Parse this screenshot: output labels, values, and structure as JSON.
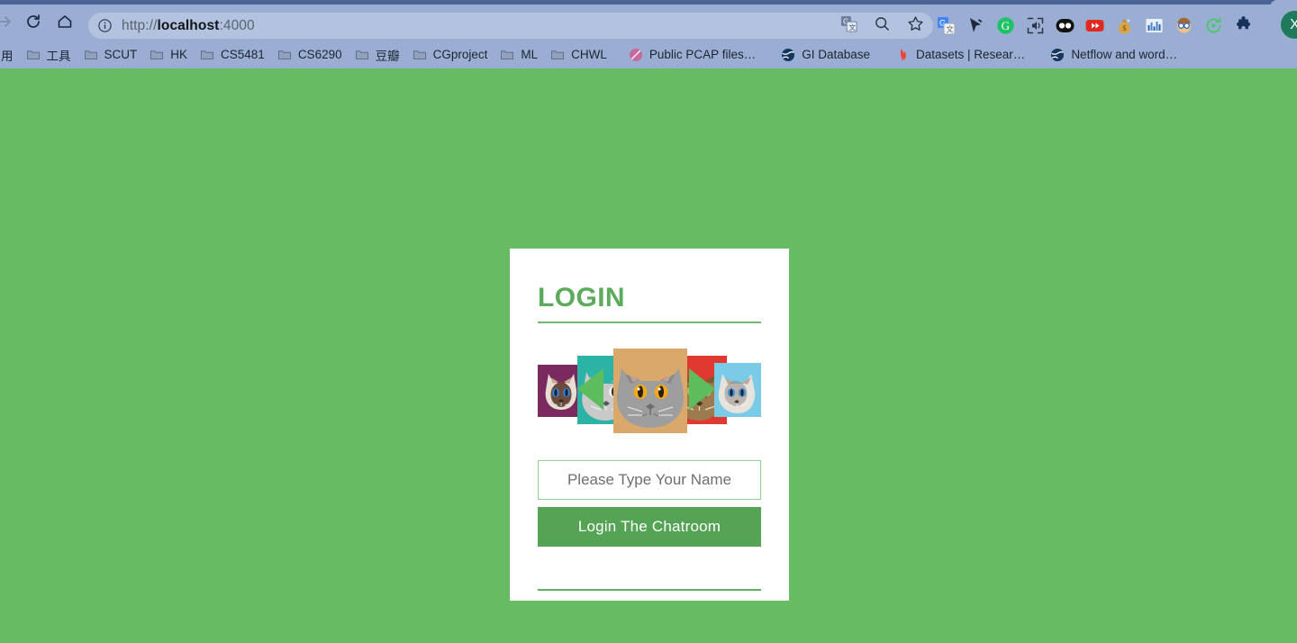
{
  "browser": {
    "nav": {
      "forward_label": "Forward",
      "reload_label": "Reload",
      "home_label": "Home"
    },
    "omnibox": {
      "url_scheme": "http://",
      "url_host": "localhost",
      "url_rest": ":4000",
      "full_url": "http://localhost:4000",
      "site_info_icon": "info-circle-icon",
      "translate_icon": "google-translate-icon",
      "search_icon": "search-icon",
      "bookmark_icon": "star-icon"
    },
    "extensions": [
      {
        "name": "google-translate-icon",
        "label": "Google Translate"
      },
      {
        "name": "cursor-pointer-icon",
        "label": "Cursor"
      },
      {
        "name": "grammarly-icon",
        "label": "Grammarly"
      },
      {
        "name": "speaker-icon",
        "label": "Read Aloud"
      },
      {
        "name": "dual-dot-icon",
        "label": "Dual Dot"
      },
      {
        "name": "youtube-icon",
        "label": "YouTube"
      },
      {
        "name": "money-bag-icon",
        "label": "Money Bag"
      },
      {
        "name": "chart-icon",
        "label": "Chart"
      },
      {
        "name": "face-glasses-icon",
        "label": "Face With Glasses"
      },
      {
        "name": "green-refresh-icon",
        "label": "Refresh"
      },
      {
        "name": "puzzle-icon",
        "label": "Extensions"
      }
    ],
    "profile": {
      "initial": "X",
      "color": "#1e7a5a"
    },
    "bookmarks": [
      {
        "label": "用",
        "icon": "partial-label",
        "truncated": true
      },
      {
        "label": "工具",
        "icon": "folder-icon"
      },
      {
        "label": "SCUT",
        "icon": "folder-icon"
      },
      {
        "label": "HK",
        "icon": "folder-icon"
      },
      {
        "label": "CS5481",
        "icon": "folder-icon"
      },
      {
        "label": "CS6290",
        "icon": "folder-icon"
      },
      {
        "label": "豆瓣",
        "icon": "folder-icon"
      },
      {
        "label": "CGproject",
        "icon": "folder-icon"
      },
      {
        "label": "ML",
        "icon": "folder-icon"
      },
      {
        "label": "CHWL",
        "icon": "folder-icon"
      },
      {
        "label": "Public PCAP files…",
        "icon": "pink-circle-icon"
      },
      {
        "label": "GI Database",
        "icon": "globe-icon"
      },
      {
        "label": "Datasets | Resear…",
        "icon": "red-crescent-icon"
      },
      {
        "label": "Netflow and word…",
        "icon": "globe-icon"
      }
    ]
  },
  "page": {
    "background_color": "#66bb63",
    "card": {
      "title": "LOGIN",
      "title_color": "#5cab5c",
      "accent_color": "#55a455",
      "carousel": {
        "name": "cat-image-carousel",
        "prev_arrow_label": "Previous",
        "next_arrow_label": "Next",
        "arrow_color": "#5dbd5d",
        "slides": [
          {
            "alt": "siamese-cat-purple",
            "bg": "#7a2a5e"
          },
          {
            "alt": "grey-cat-teal",
            "bg": "#2bb3a6"
          },
          {
            "alt": "british-shorthair-tan",
            "bg": "#d9a86a"
          },
          {
            "alt": "tabby-cat-red",
            "bg": "#e03a30"
          },
          {
            "alt": "siamese-cat-blue",
            "bg": "#79cbe8"
          }
        ]
      },
      "name_input": {
        "placeholder": "Please Type Your Name",
        "value": ""
      },
      "login_button_label": "Login The Chatroom"
    }
  }
}
